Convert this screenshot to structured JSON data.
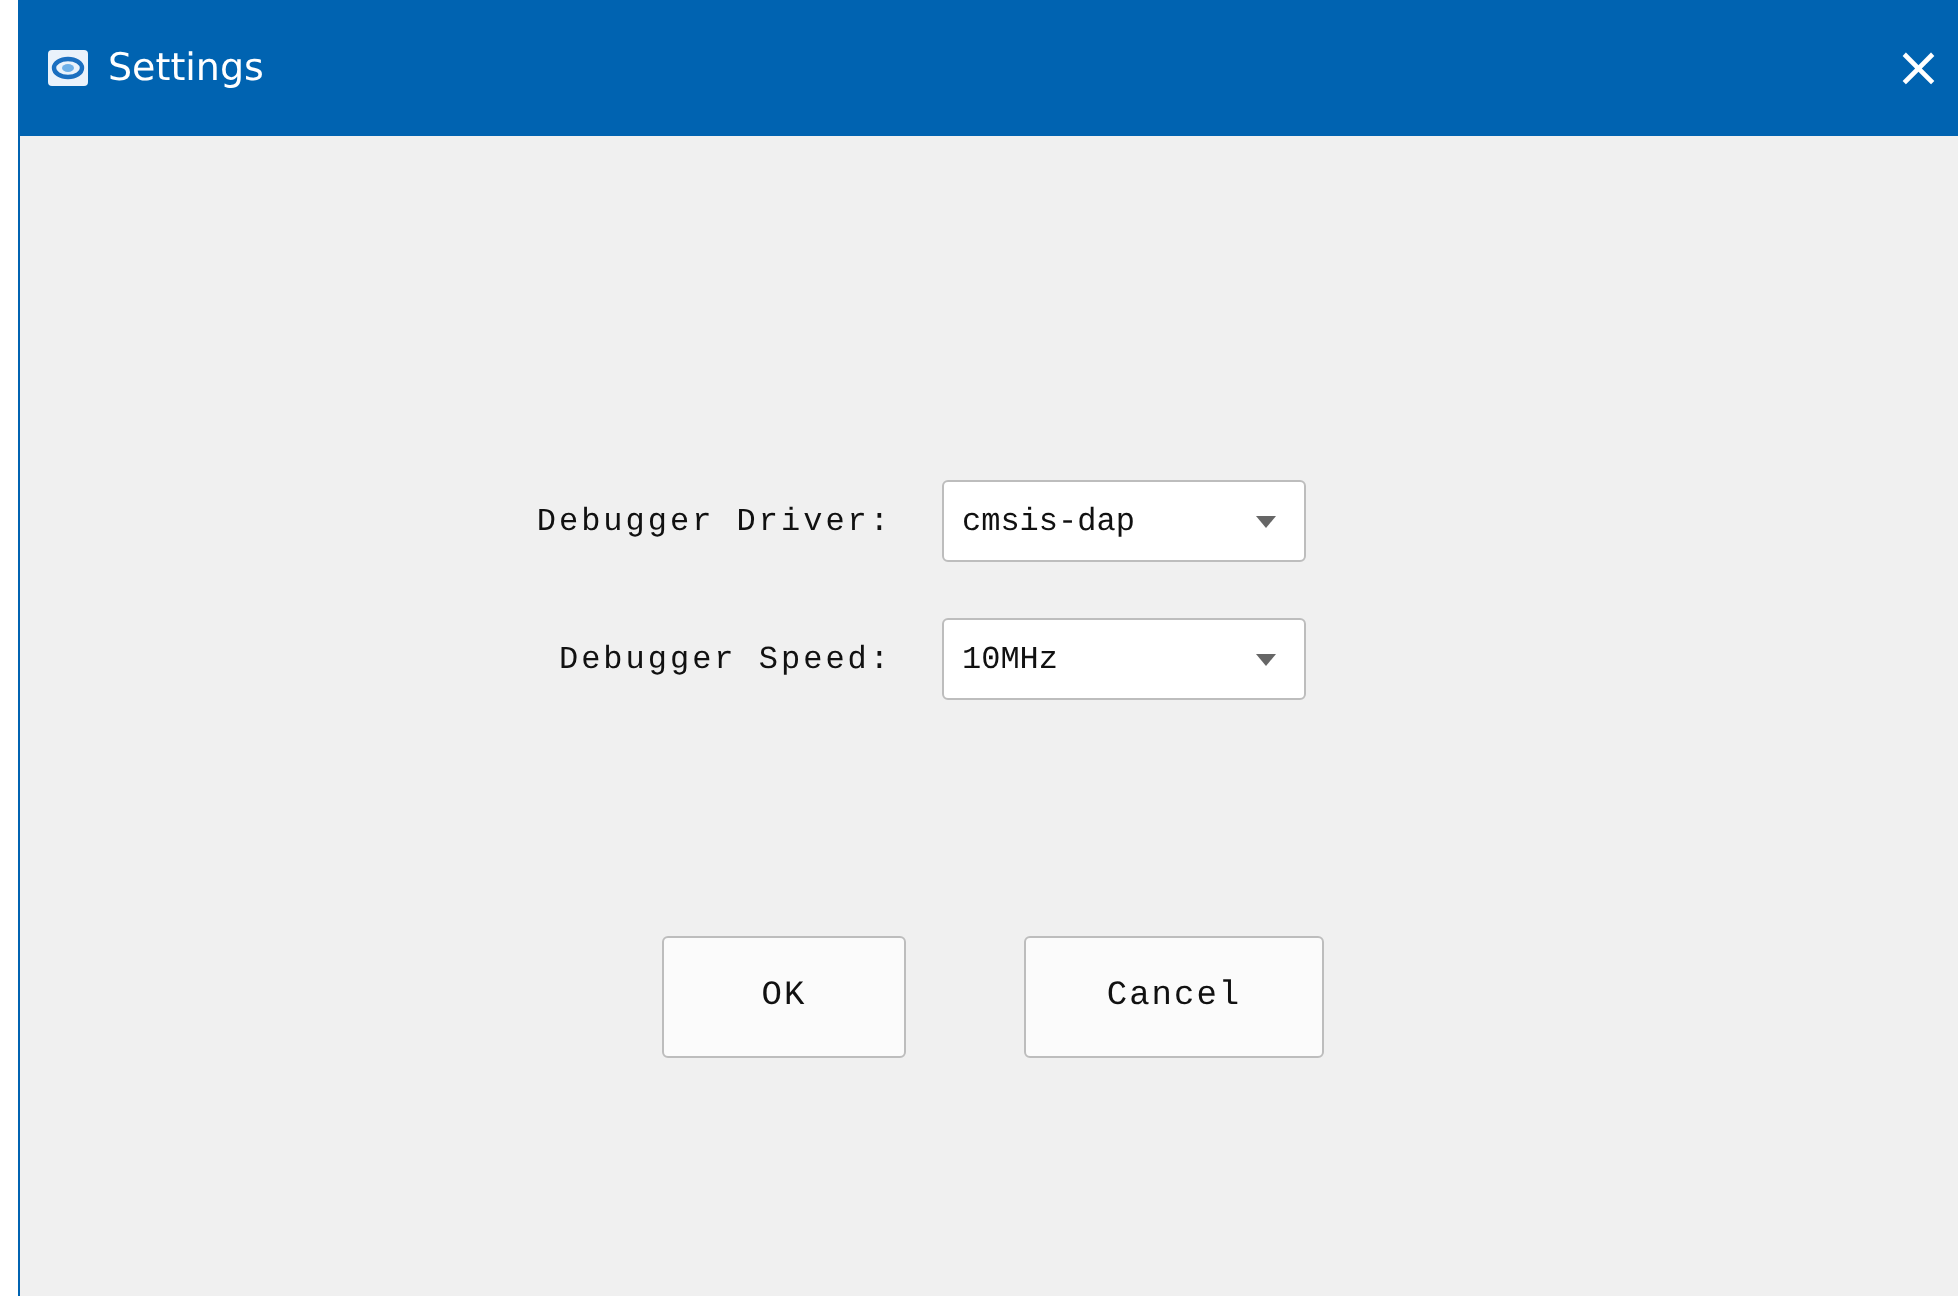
{
  "window": {
    "title": "Settings",
    "close": "×"
  },
  "fields": [
    {
      "label": "Debugger Driver:",
      "value": "cmsis-dap"
    },
    {
      "label": "Debugger Speed:",
      "value": "10MHz"
    }
  ],
  "buttons": [
    "OK",
    "Cancel"
  ]
}
